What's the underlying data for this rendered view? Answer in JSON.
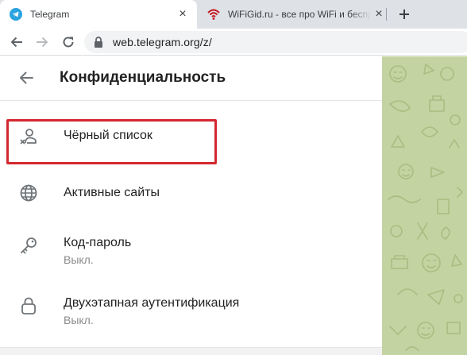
{
  "browser": {
    "tabs": [
      {
        "title": "Telegram",
        "active": true
      },
      {
        "title": "WiFiGid.ru - все про WiFi и беспроводные технологии",
        "active": false
      }
    ],
    "close_glyph": "×",
    "new_tab_glyph": "+",
    "url": "web.telegram.org/z/"
  },
  "telegram": {
    "header_title": "Конфиденциальность",
    "items": [
      {
        "label": "Чёрный список",
        "subtitle": "",
        "icon": "blocked-user-icon"
      },
      {
        "label": "Активные сайты",
        "subtitle": "",
        "icon": "globe-icon"
      },
      {
        "label": "Код-пароль",
        "subtitle": "Выкл.",
        "icon": "key-icon"
      },
      {
        "label": "Двухэтапная аутентификация",
        "subtitle": "Выкл.",
        "icon": "lock-icon"
      }
    ]
  },
  "colors": {
    "highlight": "#d3282e",
    "telegram_blue": "#2aa3df",
    "wallpaper": "#c3d3a1",
    "tabstrip": "#dee1e6"
  }
}
